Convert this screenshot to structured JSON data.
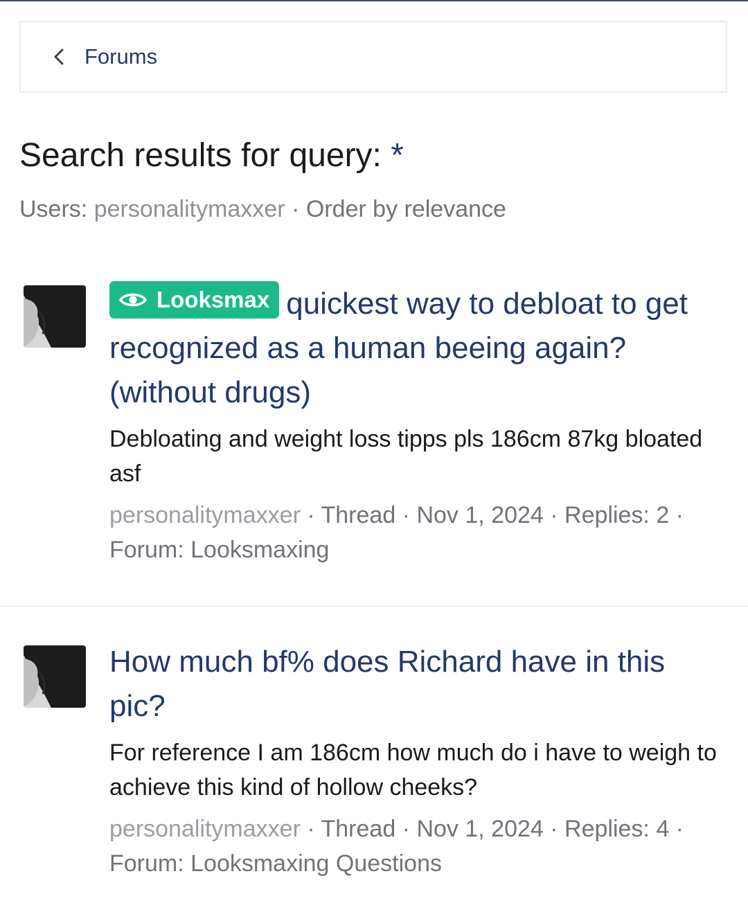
{
  "breadcrumb": {
    "label": "Forums"
  },
  "search": {
    "title_prefix": "Search results for query:",
    "query": "*",
    "filters_prefix": "Users:",
    "user": "personalitymaxxer",
    "separator": "·",
    "order": "Order by relevance"
  },
  "results": [
    {
      "badge": "Looksmax",
      "title": "quickest way to debloat to get recognized as a human beeing again? (without drugs)",
      "snippet": "Debloating and weight loss tipps pls 186cm 87kg bloated asf",
      "meta": {
        "user": "personalitymaxxer",
        "type": "Thread",
        "date": "Nov 1, 2024",
        "replies": "Replies: 2",
        "forum": "Forum: Looksmaxing"
      }
    },
    {
      "title": "How much bf% does Richard have in this pic?",
      "snippet": "For reference I am 186cm how much do i have to weigh to achieve this kind of hollow cheeks?",
      "meta": {
        "user": "personalitymaxxer",
        "type": "Thread",
        "date": "Nov 1, 2024",
        "replies": "Replies: 4",
        "forum": "Forum: Looksmaxing Questions"
      }
    }
  ],
  "colors": {
    "link": "#23396b",
    "badge": "#1cba8a",
    "meta": "#6f737a"
  },
  "icons": {
    "back": "chevron-left-icon",
    "badge": "eye-icon"
  }
}
